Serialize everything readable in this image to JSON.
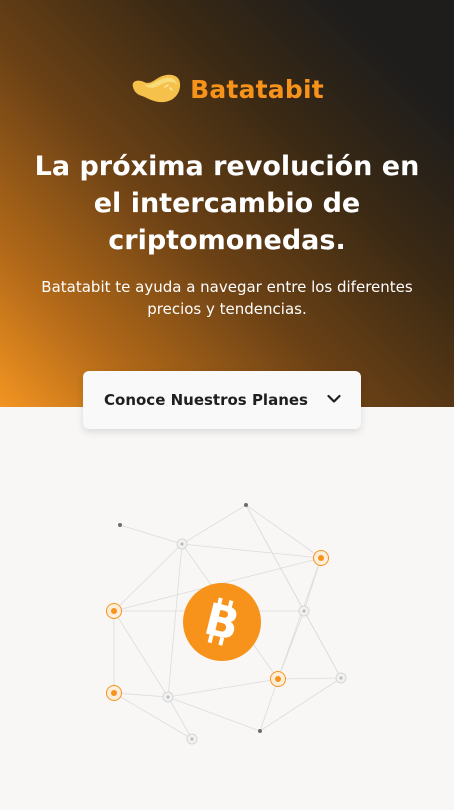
{
  "brand": {
    "name": "Batatabit",
    "logo_icon": "potato-logo-icon",
    "accent_color": "#f7931a"
  },
  "hero": {
    "headline": "La próxima revolución en el intercambio de criptomonedas.",
    "subtitle": "Batatabit te ayuda a navegar entre los diferentes precios y tendencias.",
    "gradient": [
      "#1e1d1c",
      "#f39422"
    ]
  },
  "plans_button": {
    "label": "Conoce Nuestros Planes",
    "icon": "chevron-down-icon"
  },
  "illustration": {
    "icon": "bitcoin-icon",
    "node_color": "#f7931a"
  }
}
